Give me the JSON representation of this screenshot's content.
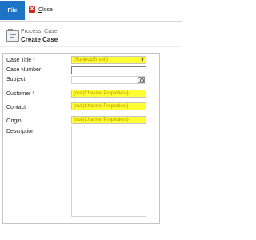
{
  "ribbon": {
    "file_label": "File",
    "close_label": "Close",
    "close_underline": "C",
    "close_rest": "lose"
  },
  "header": {
    "process_text": "Process: Case",
    "title": "Create Case"
  },
  "form": {
    "case_title": {
      "label": "Case Title",
      "required": "*",
      "value": "{Subject(Email)}"
    },
    "case_number": {
      "label": "Case Number",
      "value": ""
    },
    "subject": {
      "label": "Subject",
      "value": ""
    },
    "customer": {
      "label": "Customer",
      "required": "*",
      "value": "{null(Channel Properties)}"
    },
    "contact": {
      "label": "Contact",
      "value": "{null(Channel Properties)}"
    },
    "origin": {
      "label": "Origin",
      "value": "{null(Channel Properties)}"
    },
    "description": {
      "label": "Description",
      "value": ""
    }
  },
  "colors": {
    "file_tab": "#1d74c7",
    "highlight": "#ffff33",
    "required": "#d81c1c",
    "close_icon": "#cc2a1c"
  },
  "icons": {
    "close": "close-icon",
    "lookup": "lookup-icon",
    "form": "case-form-icon"
  }
}
